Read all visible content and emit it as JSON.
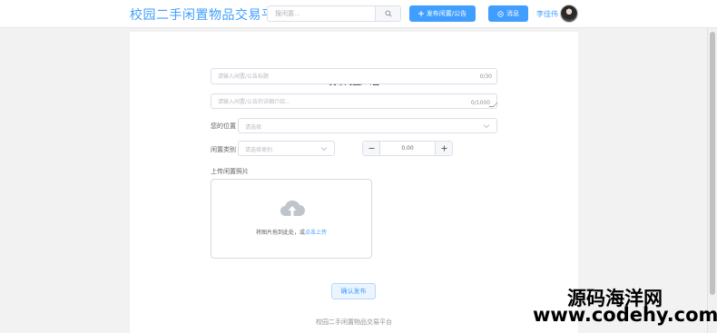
{
  "header": {
    "site_title": "校园二手闲置物品交易平台",
    "search_placeholder": "搜闲置...",
    "publish_button": "发布闲置/公告",
    "message_button": "消息",
    "username": "李佳伟"
  },
  "form": {
    "title": "发布闲置/公告",
    "title_input_placeholder": "请输入闲置/公告标题",
    "title_counter": "0/30",
    "desc_placeholder": "请输入闲置/公告的详细介绍...",
    "desc_counter": "0/1000",
    "location_label": "您的位置",
    "location_placeholder": "请选择",
    "type_label": "闲置类别",
    "type_placeholder": "请选择类别",
    "price_value": "0.00",
    "photo_label": "上传闲置照片",
    "upload_hint": "将图片拖到此处，或",
    "upload_link": "点击上传",
    "confirm_button": "确认发布"
  },
  "footer": {
    "text": "校园二手闲置物品交易平台"
  },
  "watermark": {
    "brand": "源码海洋网",
    "url": "www.codehy.com"
  },
  "colors": {
    "accent": "#409eff",
    "page_bg": "#f2f2f2",
    "card_bg": "#ffffff",
    "border": "#dcdfe6"
  }
}
